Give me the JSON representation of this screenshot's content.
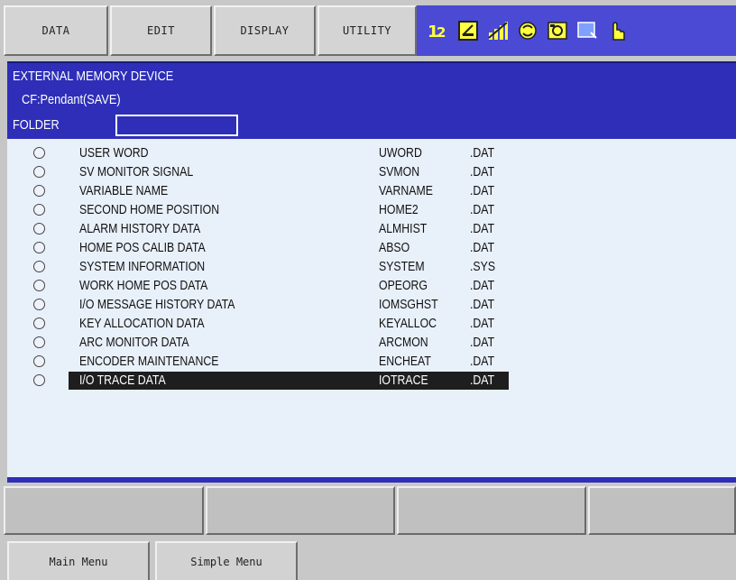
{
  "menu": {
    "data_label": "DATA",
    "edit_label": "EDIT",
    "display_label": "DISPLAY",
    "utility_label": "UTILITY"
  },
  "status_icons": [
    "mode-12-icon",
    "edit-lock-icon",
    "signal-bars-icon",
    "cycle-icon",
    "servo-icon",
    "screen-icon",
    "hand-icon"
  ],
  "colors": {
    "header_bg": "#2e2eb8",
    "list_bg": "#e8f0fa",
    "selection_bg": "#1e1e1e",
    "icon_bar_bg": "#4a4ad4"
  },
  "header": {
    "title": "EXTERNAL MEMORY DEVICE",
    "device": "CF:Pendant(SAVE)",
    "folder_label": "FOLDER",
    "folder_value": ""
  },
  "files": [
    {
      "name": "USER WORD",
      "file": "UWORD",
      "ext": ".DAT"
    },
    {
      "name": "SV MONITOR SIGNAL",
      "file": "SVMON",
      "ext": ".DAT"
    },
    {
      "name": "VARIABLE NAME",
      "file": "VARNAME",
      "ext": ".DAT"
    },
    {
      "name": "SECOND HOME POSITION",
      "file": "HOME2",
      "ext": ".DAT"
    },
    {
      "name": "ALARM HISTORY DATA",
      "file": "ALMHIST",
      "ext": ".DAT"
    },
    {
      "name": "HOME POS CALIB DATA",
      "file": "ABSO",
      "ext": ".DAT"
    },
    {
      "name": "SYSTEM INFORMATION",
      "file": "SYSTEM",
      "ext": ".SYS"
    },
    {
      "name": "WORK HOME POS DATA",
      "file": "OPEORG",
      "ext": ".DAT"
    },
    {
      "name": "I/O MESSAGE HISTORY DATA",
      "file": "IOMSGHST",
      "ext": ".DAT"
    },
    {
      "name": "KEY ALLOCATION DATA",
      "file": "KEYALLOC",
      "ext": ".DAT"
    },
    {
      "name": "ARC MONITOR DATA",
      "file": "ARCMON",
      "ext": ".DAT"
    },
    {
      "name": "ENCODER MAINTENANCE",
      "file": "ENCHEAT",
      "ext": ".DAT"
    },
    {
      "name": "I/O TRACE DATA",
      "file": "IOTRACE",
      "ext": ".DAT",
      "selected": true
    }
  ],
  "bottom": {
    "main_menu_label": "Main Menu",
    "simple_menu_label": "Simple Menu"
  }
}
